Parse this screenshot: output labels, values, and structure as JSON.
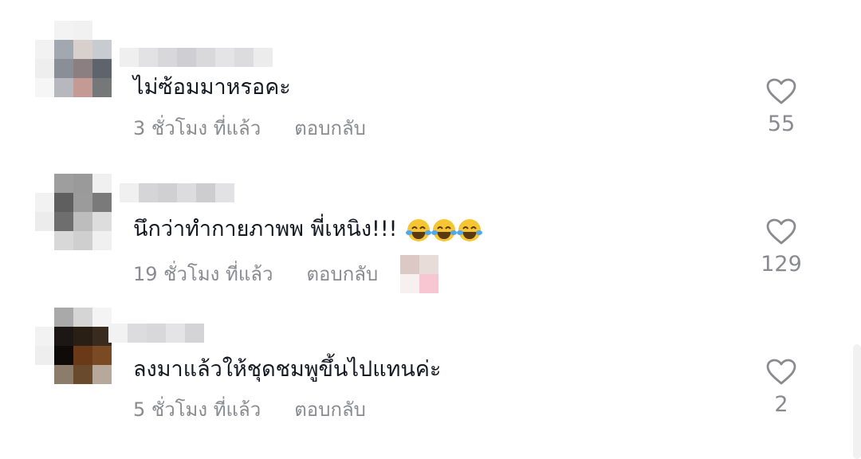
{
  "comments": [
    {
      "text": "ไม่ซ้อมมาหรอคะ",
      "time": "3 ชั่วโมง ที่แล้ว",
      "reply_label": "ตอบกลับ",
      "likes": "55",
      "avatar_icon": "blurred-avatar"
    },
    {
      "text": "นึกว่าทำกายภาพพ พี่เหนิง!!!",
      "time": "19 ชั่วโมง ที่แล้ว",
      "reply_label": "ตอบกลับ",
      "likes": "129",
      "emoji": "face-with-tears-of-joy x3",
      "avatar_icon": "blurred-avatar"
    },
    {
      "text": "ลงมาแล้วให้ชุดชมพูขึ้นไปแทนค่ะ",
      "time": "5 ชั่วโมง ที่แล้ว",
      "reply_label": "ตอบกลับ",
      "likes": "2",
      "avatar_icon": "blurred-avatar"
    }
  ],
  "colors": {
    "text": "#161823",
    "meta": "#8a8b91",
    "heart_outline": "#8a8b91"
  }
}
